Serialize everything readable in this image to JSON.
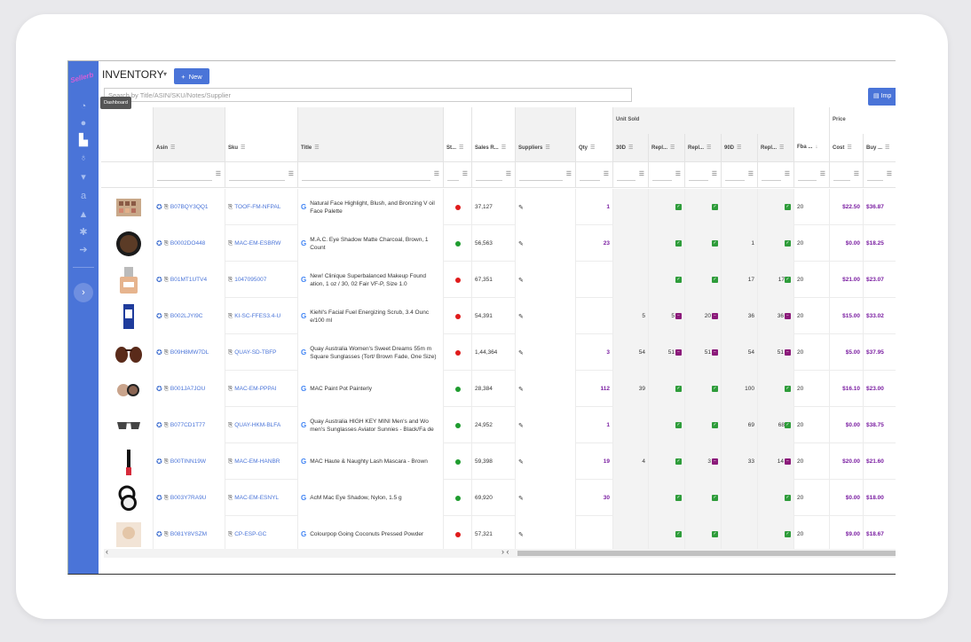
{
  "sidebar": {
    "logo": "Sellerb",
    "tooltip": "Dashboard",
    "icons": [
      "dashboard-icon",
      "info-icon",
      "inventory-icon",
      "lightbulb-icon",
      "cart-icon",
      "amazon-icon",
      "user-icon",
      "settings-icon",
      "logout-icon"
    ],
    "toggle": "›"
  },
  "header": {
    "title": "INVENTORY",
    "caret": "▾",
    "new_label": "New",
    "search_placeholder": "Search by Title/ASIN/SKU/Notes/Supplier",
    "import_label": "Imp"
  },
  "groups": {
    "unit_sold": "Unit Sold",
    "price": "Price"
  },
  "columns": {
    "asin": "Asin",
    "sku": "Sku",
    "title": "Title",
    "status": "St...",
    "sales_rank": "Sales R...",
    "suppliers": "Suppliers",
    "qty": "Qty",
    "d30": "30D",
    "repl1": "Repl...",
    "repl2": "Repl...",
    "d90": "90D",
    "repl3": "Repl...",
    "fba": "Fba ...",
    "cost": "Cost",
    "buy": "Buy ..."
  },
  "rows": [
    {
      "asin": "B07BQY3QQ1",
      "sku": "TOOF-FM-NFPAL",
      "title": "Natural Face Highlight, Blush, and Bronzing V oil Face Palette",
      "status": "red",
      "rank": "37,127",
      "qty": "1",
      "d30": "",
      "r1": "check",
      "r2": "check",
      "d90": "",
      "r3": "check",
      "r3n": "",
      "fba": "20",
      "cost": "$22.50",
      "buy": "$36.87",
      "r1n": "",
      "r2n": ""
    },
    {
      "asin": "B0002DO448",
      "sku": "MAC-EM-ESBRW",
      "title": "M.A.C. Eye Shadow Matte Charcoal, Brown, 1 Count",
      "status": "green",
      "rank": "56,563",
      "qty": "23",
      "d30": "",
      "r1": "check",
      "r2": "check",
      "d90": "1",
      "r3": "check",
      "r3n": "",
      "fba": "20",
      "cost": "$0.00",
      "buy": "$18.25",
      "r1n": "",
      "r2n": ""
    },
    {
      "asin": "B01MT1UTV4",
      "sku": "1047095007",
      "title": "New! Clinique Superbalanced Makeup Found ation, 1 oz / 30, 02 Fair VF-P, Size 1.0",
      "status": "red",
      "rank": "67,351",
      "qty": "",
      "d30": "",
      "r1": "check",
      "r2": "check",
      "d90": "17",
      "r3": "check",
      "r3n": "17",
      "fba": "20",
      "cost": "$21.00",
      "buy": "$23.07",
      "r1n": "",
      "r2n": ""
    },
    {
      "asin": "B002LJYI9C",
      "sku": "KI-SC-FFES3.4-U",
      "title": "Kiehl's Facial Fuel Energizing Scrub, 3.4 Ounc e/100 ml",
      "status": "red",
      "rank": "54,391",
      "qty": "",
      "d30": "5",
      "r1": "minus",
      "r1n": "5",
      "r2": "minus",
      "r2n": "20",
      "d90": "36",
      "r3": "minus",
      "r3n": "36",
      "fba": "20",
      "cost": "$15.00",
      "buy": "$33.02"
    },
    {
      "asin": "B09H8MW7DL",
      "sku": "QUAY-SD-TBFP",
      "title": "Quay Australia Women's Sweet Dreams 55m m Square Sunglasses (Tort/ Brown Fade, One Size)",
      "status": "red",
      "rank": "1,44,364",
      "qty": "3",
      "d30": "54",
      "r1": "minus",
      "r1n": "51",
      "r2": "minus",
      "r2n": "51",
      "d90": "54",
      "r3": "minus",
      "r3n": "51",
      "fba": "20",
      "cost": "$5.00",
      "buy": "$37.95"
    },
    {
      "asin": "B001JA7JOU",
      "sku": "MAC-EM-PPPAI",
      "title": "MAC Paint Pot Painterly",
      "status": "green",
      "rank": "28,384",
      "qty": "112",
      "d30": "39",
      "r1": "check",
      "r1n": "",
      "r2": "check",
      "r2n": "",
      "d90": "100",
      "r3": "check",
      "r3n": "",
      "fba": "20",
      "cost": "$16.10",
      "buy": "$23.00"
    },
    {
      "asin": "B077CD1T77",
      "sku": "QUAY-HKM-BLFA",
      "title": "Quay Australia HIGH KEY MINI Men's and Wo men's Sunglasses Aviator Sunnies - Black/Fa de",
      "status": "green",
      "rank": "24,952",
      "qty": "1",
      "d30": "",
      "r1": "check",
      "r1n": "",
      "r2": "check",
      "r2n": "",
      "d90": "69",
      "r3": "check",
      "r3n": "68",
      "fba": "20",
      "cost": "$0.00",
      "buy": "$38.75"
    },
    {
      "asin": "B00TINN19W",
      "sku": "MAC-EM-HANBR",
      "title": "MAC Haute & Naughty Lash Mascara - Brown",
      "status": "green",
      "rank": "59,398",
      "qty": "19",
      "d30": "4",
      "r1": "check",
      "r1n": "",
      "r2": "minus",
      "r2n": "3",
      "d90": "33",
      "r3": "minus",
      "r3n": "14",
      "fba": "20",
      "cost": "$20.00",
      "buy": "$21.60"
    },
    {
      "asin": "B003Y7RA9U",
      "sku": "MAC-EM-ESNYL",
      "title": "AcM Mac Eye Shadow, Nylon, 1.5 g",
      "status": "green",
      "rank": "69,920",
      "qty": "30",
      "d30": "",
      "r1": "check",
      "r1n": "",
      "r2": "check",
      "r2n": "",
      "d90": "",
      "r3": "check",
      "r3n": "",
      "fba": "20",
      "cost": "$0.00",
      "buy": "$18.00"
    },
    {
      "asin": "B081Y8VSZM",
      "sku": "CP-ESP-GC",
      "title": "Colourpop Going Coconuts Pressed Powder",
      "status": "red",
      "rank": "57,321",
      "qty": "",
      "d30": "",
      "r1": "check",
      "r1n": "",
      "r2": "check",
      "r2n": "",
      "d90": "",
      "r3": "check",
      "r3n": "",
      "fba": "20",
      "cost": "$9.00",
      "buy": "$18.67"
    }
  ],
  "scroll": {
    "left": "‹",
    "right": "›",
    "mid": "› ‹"
  },
  "colors": {
    "accent": "#4a74d8",
    "price": "#7b1fa2",
    "ok": "#2e9c3a",
    "alert": "#8b1a7a"
  }
}
